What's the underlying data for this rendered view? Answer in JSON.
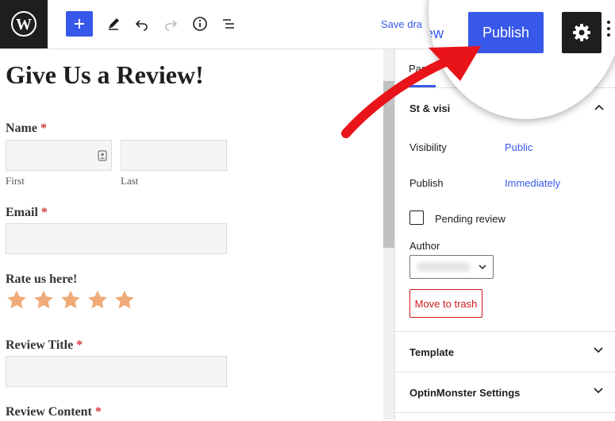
{
  "toolbar": {
    "save_draft": "Save dra"
  },
  "form": {
    "title": "Give Us a Review!",
    "name_label": "Name",
    "required_mark": "*",
    "first_sublabel": "First",
    "last_sublabel": "Last",
    "email_label": "Email",
    "rate_label": "Rate us here!",
    "star_rating": 5,
    "review_title_label": "Review Title",
    "review_content_label": "Review Content"
  },
  "sidebar": {
    "tab_page": "Pag",
    "status_title": "St    & visi",
    "visibility_label": "Visibility",
    "visibility_value": "Public",
    "publish_label": "Publish",
    "publish_value": "Immediately",
    "pending_review": "Pending review",
    "author_label": "Author",
    "move_to_trash": "Move to trash",
    "template": "Template",
    "optinmonster": "OptinMonster Settings"
  },
  "magnifier": {
    "preview": "iew",
    "publish": "Publish"
  },
  "colors": {
    "accent": "#3858e9",
    "star": "#f0aa78",
    "danger": "#cc1818",
    "arrow": "#e8141a"
  },
  "icons": [
    "wordpress-icon",
    "plus-icon",
    "pencil-icon",
    "undo-icon",
    "redo-icon",
    "info-icon",
    "list-view-icon",
    "gear-icon",
    "close-icon",
    "chevron-up-icon",
    "chevron-down-icon",
    "star-icon"
  ]
}
